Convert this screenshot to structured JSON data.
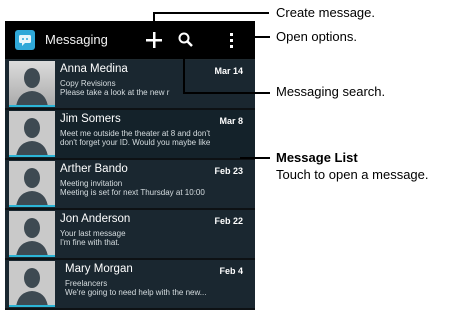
{
  "app": {
    "title": "Messaging"
  },
  "action_icons": [
    "messaging-app-icon",
    "plus-icon",
    "search-icon",
    "overflow-menu-icon"
  ],
  "messages": [
    {
      "name": "Anna Medina",
      "date": "Mar 14",
      "line1": "Copy Revisions",
      "line2": "Please take a look at the new r"
    },
    {
      "name": "Jim Somers",
      "date": "Mar 8",
      "line1": "Meet me outside the theater at 8 and don't",
      "line2": "don't forget your ID. Would you maybe like"
    },
    {
      "name": "Arther Bando",
      "date": "Feb 23",
      "line1": "Meeting invitation",
      "line2": "Meeting is set for next Thursday at 10:00"
    },
    {
      "name": "Jon Anderson",
      "date": "Feb 22",
      "line1": "Your last message",
      "line2": "I'm fine with that."
    },
    {
      "name": "Mary Morgan",
      "date": "Feb 4",
      "line1": "Freelancers",
      "line2": "We're going to need help with the new..."
    }
  ],
  "callouts": {
    "create": "Create message.",
    "options": "Open options.",
    "search": "Messaging search.",
    "list_title": "Message List",
    "list_desc": "Touch to open a message."
  },
  "colors": {
    "action_bar": "#000000",
    "row_bg": "#1a2730",
    "accent": "#2cb5d6"
  }
}
